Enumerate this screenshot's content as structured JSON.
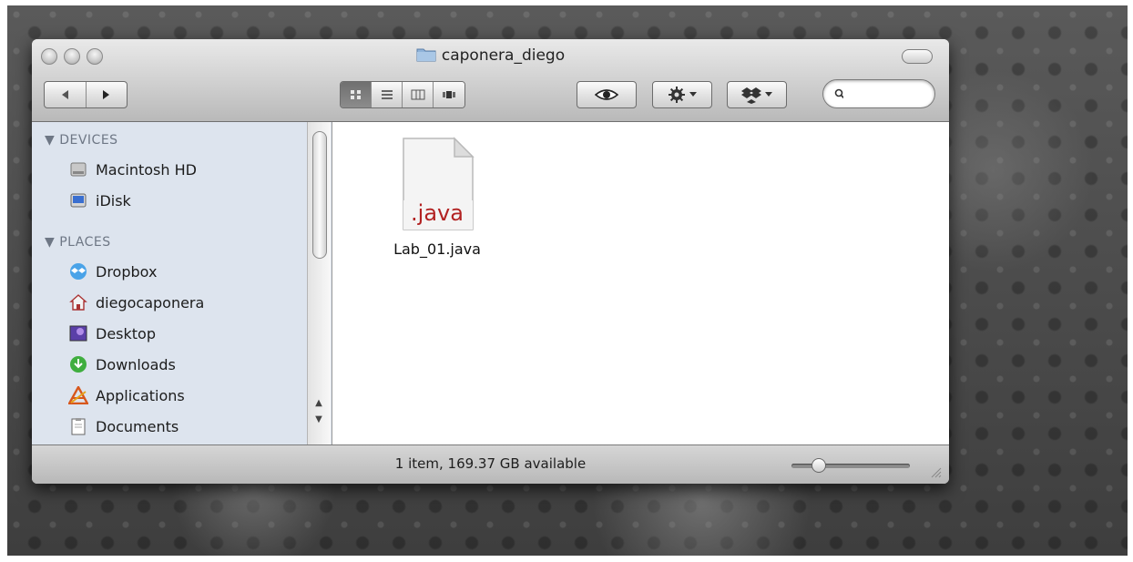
{
  "window": {
    "title": "caponera_diego"
  },
  "toolbar": {
    "back_icon": "back-arrow-icon",
    "forward_icon": "forward-arrow-icon",
    "view_modes": [
      "icon-view",
      "list-view",
      "column-view",
      "cover-flow"
    ],
    "active_view": "icon-view",
    "quicklook_icon": "eye-icon",
    "action_icon": "gear-icon",
    "dropbox_icon": "dropbox-icon",
    "search_placeholder": ""
  },
  "sidebar": {
    "devices_header": "▼ DEVICES",
    "devices": [
      {
        "label": "Macintosh HD",
        "icon": "hard-drive-icon"
      },
      {
        "label": "iDisk",
        "icon": "idisk-icon"
      }
    ],
    "places_header": "▼ PLACES",
    "places": [
      {
        "label": "Dropbox",
        "icon": "dropbox-icon"
      },
      {
        "label": "diegocaponera",
        "icon": "home-icon"
      },
      {
        "label": "Desktop",
        "icon": "desktop-icon"
      },
      {
        "label": "Downloads",
        "icon": "downloads-icon"
      },
      {
        "label": "Applications",
        "icon": "applications-icon"
      },
      {
        "label": "Documents",
        "icon": "documents-icon"
      }
    ]
  },
  "content": {
    "files": [
      {
        "name": "Lab_01.java",
        "type_label": ".java"
      }
    ]
  },
  "status": {
    "text": "1 item, 169.37 GB available",
    "zoom_level": 0.2
  },
  "colors": {
    "sidebar_bg": "#dde4ee",
    "java_label": "#b22222"
  }
}
